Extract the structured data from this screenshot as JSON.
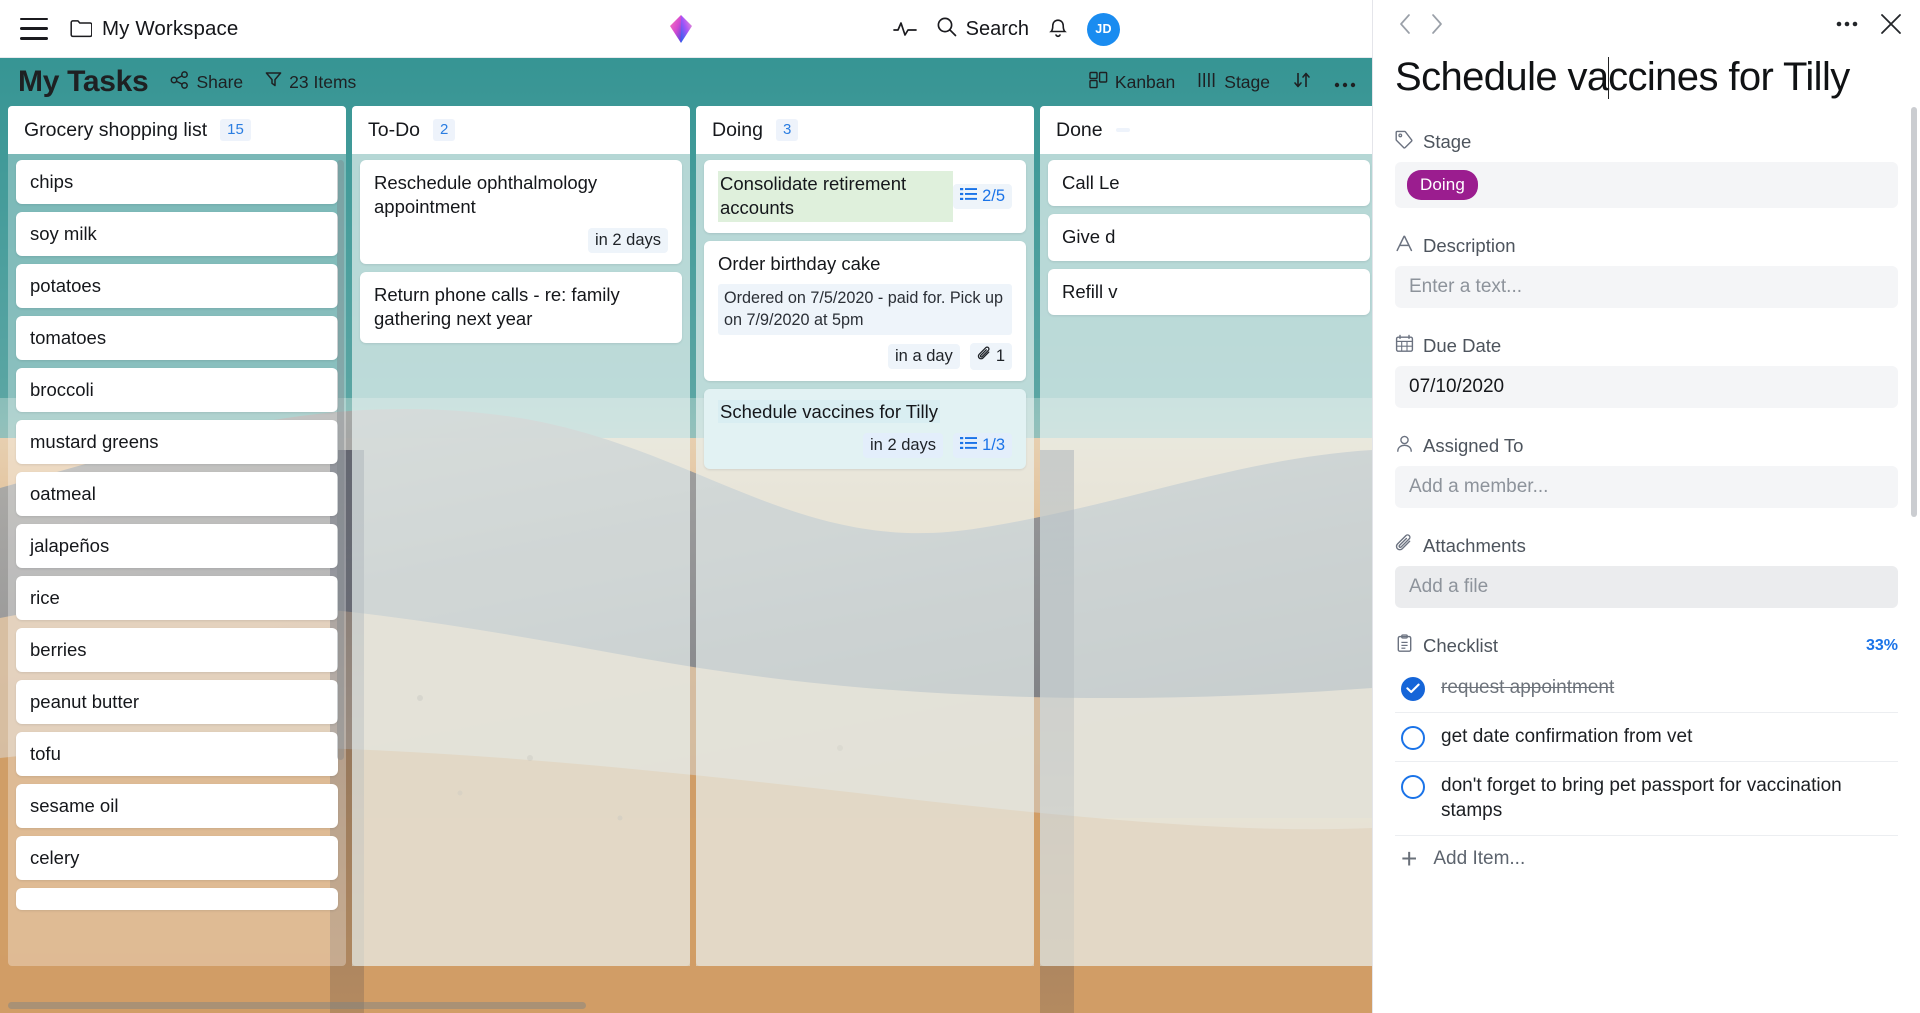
{
  "topbar": {
    "menu_icon": "hamburger-icon",
    "folder_icon": "folder-icon",
    "workspace_name": "My Workspace",
    "logo_icon": "diamond-logo-icon",
    "activity_icon": "activity-pulse-icon",
    "search_icon": "search-icon",
    "search_label": "Search",
    "bell_icon": "bell-icon",
    "avatar_initials": "JD"
  },
  "board": {
    "title": "My Tasks",
    "share_label": "Share",
    "share_icon": "share-icon",
    "filter_icon": "filter-icon",
    "items_label": "23 Items",
    "view_label": "Kanban",
    "view_icon": "kanban-icon",
    "group_label": "Stage",
    "group_icon": "columns-icon",
    "sort_icon": "sort-icon",
    "more_icon": "more-horizontal-icon"
  },
  "columns": [
    {
      "name": "Grocery shopping list",
      "count": "15",
      "type": "list",
      "items": [
        {
          "title": "chips"
        },
        {
          "title": "soy milk"
        },
        {
          "title": "potatoes"
        },
        {
          "title": "tomatoes"
        },
        {
          "title": "broccoli"
        },
        {
          "title": "mustard greens"
        },
        {
          "title": "oatmeal"
        },
        {
          "title": "jalapeños"
        },
        {
          "title": "rice"
        },
        {
          "title": "berries"
        },
        {
          "title": "peanut butter"
        },
        {
          "title": "tofu"
        },
        {
          "title": "sesame oil"
        },
        {
          "title": "celery"
        },
        {
          "title": ""
        }
      ]
    },
    {
      "name": "To-Do",
      "count": "2",
      "type": "cards",
      "items": [
        {
          "title": "Reschedule ophthalmology appointment",
          "due": "in 2 days"
        },
        {
          "title": "Return phone calls - re: family gathering next year"
        }
      ]
    },
    {
      "name": "Doing",
      "count": "3",
      "type": "cards",
      "items": [
        {
          "title": "Consolidate retirement accounts",
          "checklist": "2/5",
          "highlight": "green"
        },
        {
          "title": "Order birthday cake",
          "description": "Ordered on 7/5/2020 - paid for. Pick up on 7/9/2020 at 5pm",
          "due": "in a day",
          "attachments": "1"
        },
        {
          "title": "Schedule vaccines for Tilly",
          "due": "in 2 days",
          "checklist": "1/3",
          "highlight": "blue",
          "selected": true
        }
      ]
    },
    {
      "name": "Done",
      "count": "",
      "type": "cards",
      "items": [
        {
          "title": "Call Le"
        },
        {
          "title": "Give d"
        },
        {
          "title": "Refill v"
        }
      ]
    }
  ],
  "panel": {
    "back_icon": "chevron-left-icon",
    "forward_icon": "chevron-right-icon",
    "more_icon": "more-horizontal-icon",
    "close_icon": "close-icon",
    "title_before_caret": "Schedule va",
    "title_after_caret": "ccines for Tilly",
    "stage": {
      "label": "Stage",
      "icon": "tag-icon",
      "value": "Doing",
      "color": "#9b1d8f"
    },
    "description": {
      "label": "Description",
      "icon": "text-icon",
      "placeholder": "Enter a text..."
    },
    "due_date": {
      "label": "Due Date",
      "icon": "calendar-icon",
      "value": "07/10/2020"
    },
    "assigned_to": {
      "label": "Assigned To",
      "icon": "person-icon",
      "placeholder": "Add a member..."
    },
    "attachments": {
      "label": "Attachments",
      "icon": "paperclip-icon",
      "placeholder": "Add a file"
    },
    "checklist": {
      "label": "Checklist",
      "icon": "clipboard-icon",
      "percent": "33%",
      "items": [
        {
          "text": "request appointment",
          "done": true
        },
        {
          "text": "get date confirmation from vet",
          "done": false
        },
        {
          "text": "don't forget to bring pet passport for vaccination stamps",
          "done": false
        }
      ],
      "add_label": "Add Item..."
    }
  },
  "colors": {
    "accent_blue": "#1a73e8",
    "board_teal": "#4aa8a6",
    "stage_purple": "#9b1d8f"
  }
}
